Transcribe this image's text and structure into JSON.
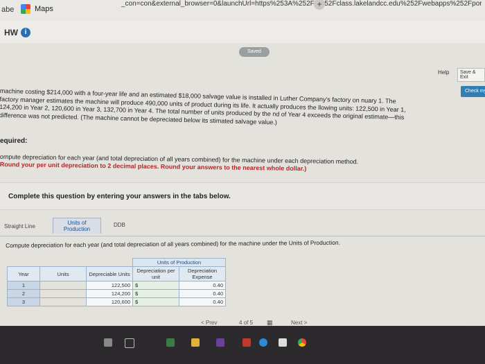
{
  "browser": {
    "tab_fragment": "abe",
    "maps_label": "Maps",
    "url": "_con=con&external_browser=0&launchUrl=https%253A%252F%252Fclass.lakelandcc.edu%252Fwebapps%252Fportal%252"
  },
  "header": {
    "hw": "HW",
    "info_icon": "info-icon",
    "saved": "Saved",
    "help": "Help",
    "save_exit": "Save & Exit",
    "check": "Check my"
  },
  "problem": {
    "text": "machine costing $214,000 with a four-year life and an estimated $18,000 salvage value is installed in Luther Company's factory on nuary 1. The factory manager estimates the machine will produce 490,000 units of product during its life. It actually produces the llowing units: 122,500 in Year 1, 124,200 in Year 2, 120,600 in Year 3, 132,700 in Year 4. The total number of units produced by the nd of Year 4 exceeds the original estimate—this difference was not predicted. (The machine cannot be depreciated below its stimated salvage value.)"
  },
  "required": {
    "title": "equired:",
    "line1": "ompute depreciation for each year (and total depreciation of all years combined) for the machine under each depreciation method.",
    "line2": "Round your per unit depreciation to 2 decimal places. Round your answers to the nearest whole dollar.)"
  },
  "banner": "Complete this question by entering your answers in the tabs below.",
  "tabs": [
    "Straight Line",
    "Units of Production",
    "DDB"
  ],
  "compute_text": "Compute depreciation for each year (and total depreciation of all years combined) for the machine under the Units of Production.",
  "table": {
    "group_header": "Units of Production",
    "headers": [
      "Year",
      "Units",
      "Depreciable Units",
      "Depreciation per unit",
      "Depreciation Expense"
    ],
    "rows": [
      {
        "year": "1",
        "units": "122,500",
        "dollar": "$",
        "rate": "0.40"
      },
      {
        "year": "2",
        "units": "124,200",
        "dollar": "$",
        "rate": "0.40"
      },
      {
        "year": "3",
        "units": "120,600",
        "dollar": "$",
        "rate": "0.40"
      }
    ]
  },
  "pager": {
    "prev": "< Prev",
    "page": "4",
    "of": "of",
    "total": "5",
    "next": "Next >"
  },
  "taskbar": {
    "clock": "7:22 PM"
  }
}
